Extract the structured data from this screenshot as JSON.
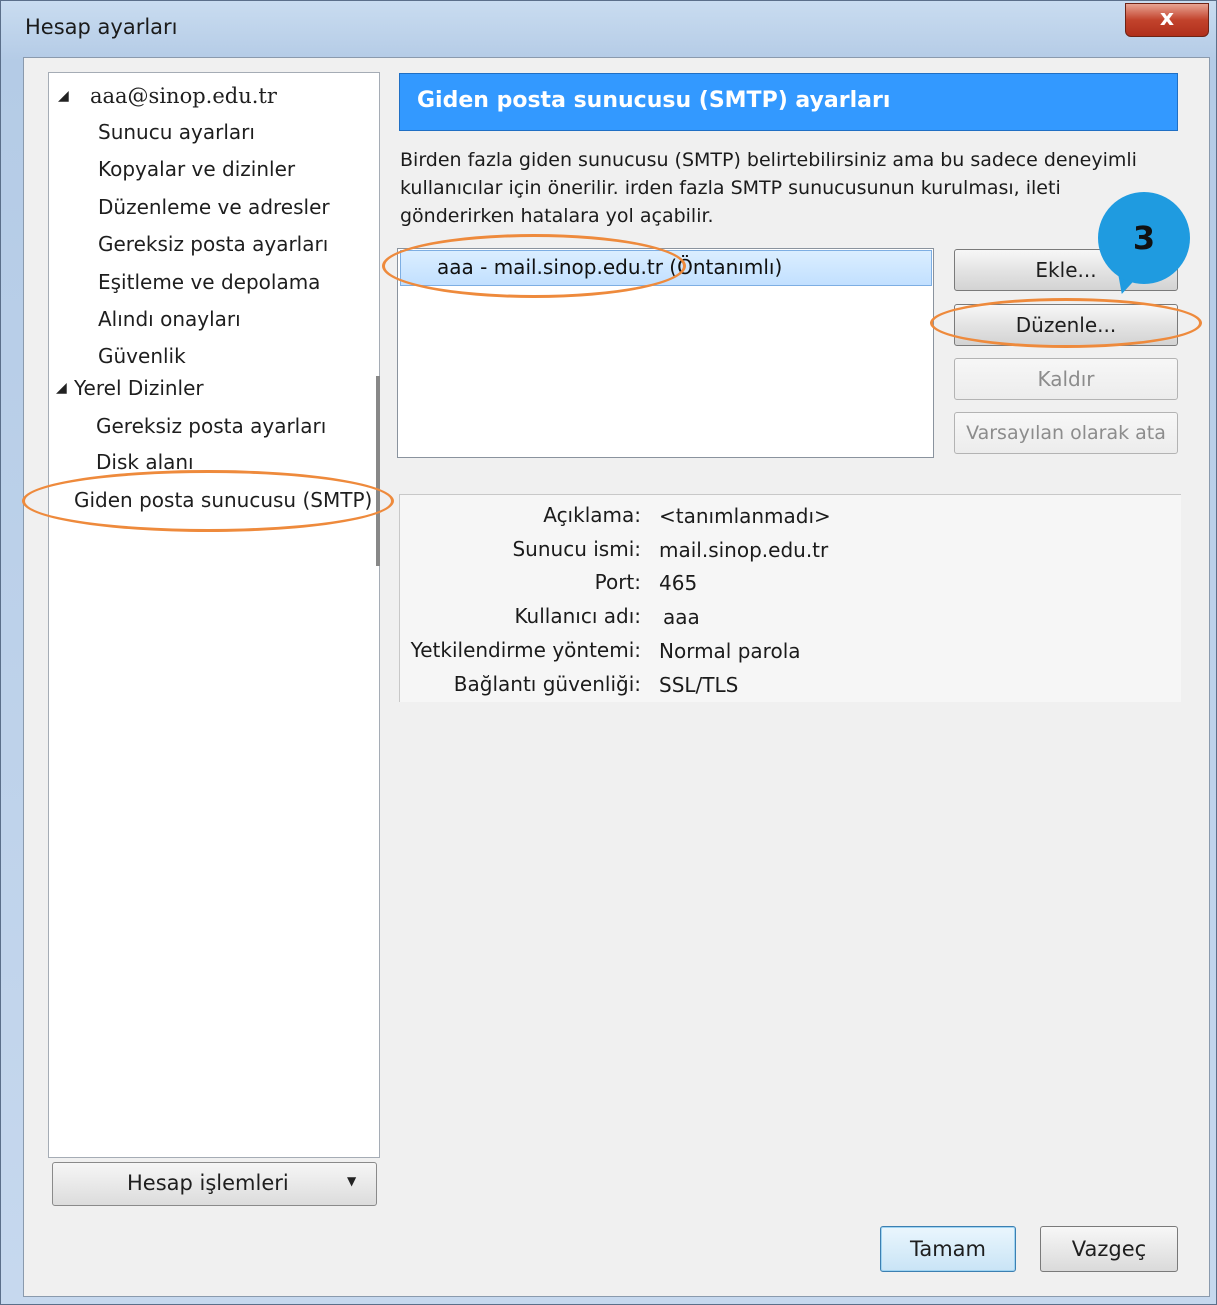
{
  "window": {
    "title": "Hesap ayarları",
    "close_glyph": "x"
  },
  "tree": {
    "account": "aaa@sinop.edu.tr",
    "account_items": [
      "Sunucu ayarları",
      "Kopyalar ve dizinler",
      "Düzenleme ve adresler",
      "Gereksiz posta ayarları",
      "Eşitleme ve depolama",
      "Alındı onayları",
      "Güvenlik"
    ],
    "local": "Yerel Dizinler",
    "local_items": [
      "Gereksiz posta ayarları",
      "Disk alanı"
    ],
    "smtp": "Giden posta sunucusu (SMTP)"
  },
  "account_actions": {
    "label": "Hesap işlemleri"
  },
  "panel": {
    "title": "Giden posta sunucusu (SMTP) ayarları",
    "description": "Birden fazla giden sunucusu (SMTP) belirtebilirsiniz ama bu sadece deneyimli kullanıcılar için önerilir. irden fazla SMTP sunucusunun kurulması, ileti gönderirken hatalara yol açabilir.",
    "server_entry": "aaa  - mail.sinop.edu.tr (Öntanımlı)",
    "buttons": {
      "add": "Ekle...",
      "edit": "Düzenle...",
      "remove": "Kaldır",
      "set_default": "Varsayılan olarak ata"
    },
    "details": {
      "labels": [
        "Açıklama:",
        "Sunucu ismi:",
        "Port:",
        "Kullanıcı adı:",
        "Yetkilendirme yöntemi:",
        "Bağlantı güvenliği:"
      ],
      "values": [
        "<tanımlanmadı>",
        "mail.sinop.edu.tr",
        "465",
        "aaa",
        "Normal parola",
        "SSL/TLS"
      ]
    }
  },
  "footer": {
    "ok": "Tamam",
    "cancel": "Vazgeç"
  },
  "annotation": {
    "step": "3",
    "color": "#ee8a3c",
    "bubble_color": "#1f9be0"
  }
}
